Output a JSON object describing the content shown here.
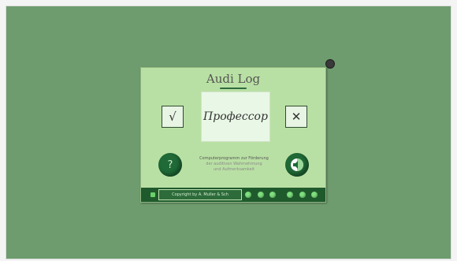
{
  "app": {
    "title": "Audi Log",
    "word": "Профессор",
    "yes_label": "√",
    "no_label": "✕",
    "help_label": "?",
    "description": [
      "Computerprogramm zur Förderung",
      "der auditiven Wahrnehmung",
      "und Aufmerksamkeit"
    ],
    "credit": "Copyright by A. Muller & Sch"
  },
  "colors": {
    "desktop_bg": "#6e9c6e",
    "panel_bg": "#b9e0a4",
    "dark_green": "#1f6a36",
    "bar_green": "#1f5a2c",
    "led_green": "#7fe07f"
  },
  "icons": {
    "sound": "speaker-icon",
    "close": "close-dot-icon"
  }
}
